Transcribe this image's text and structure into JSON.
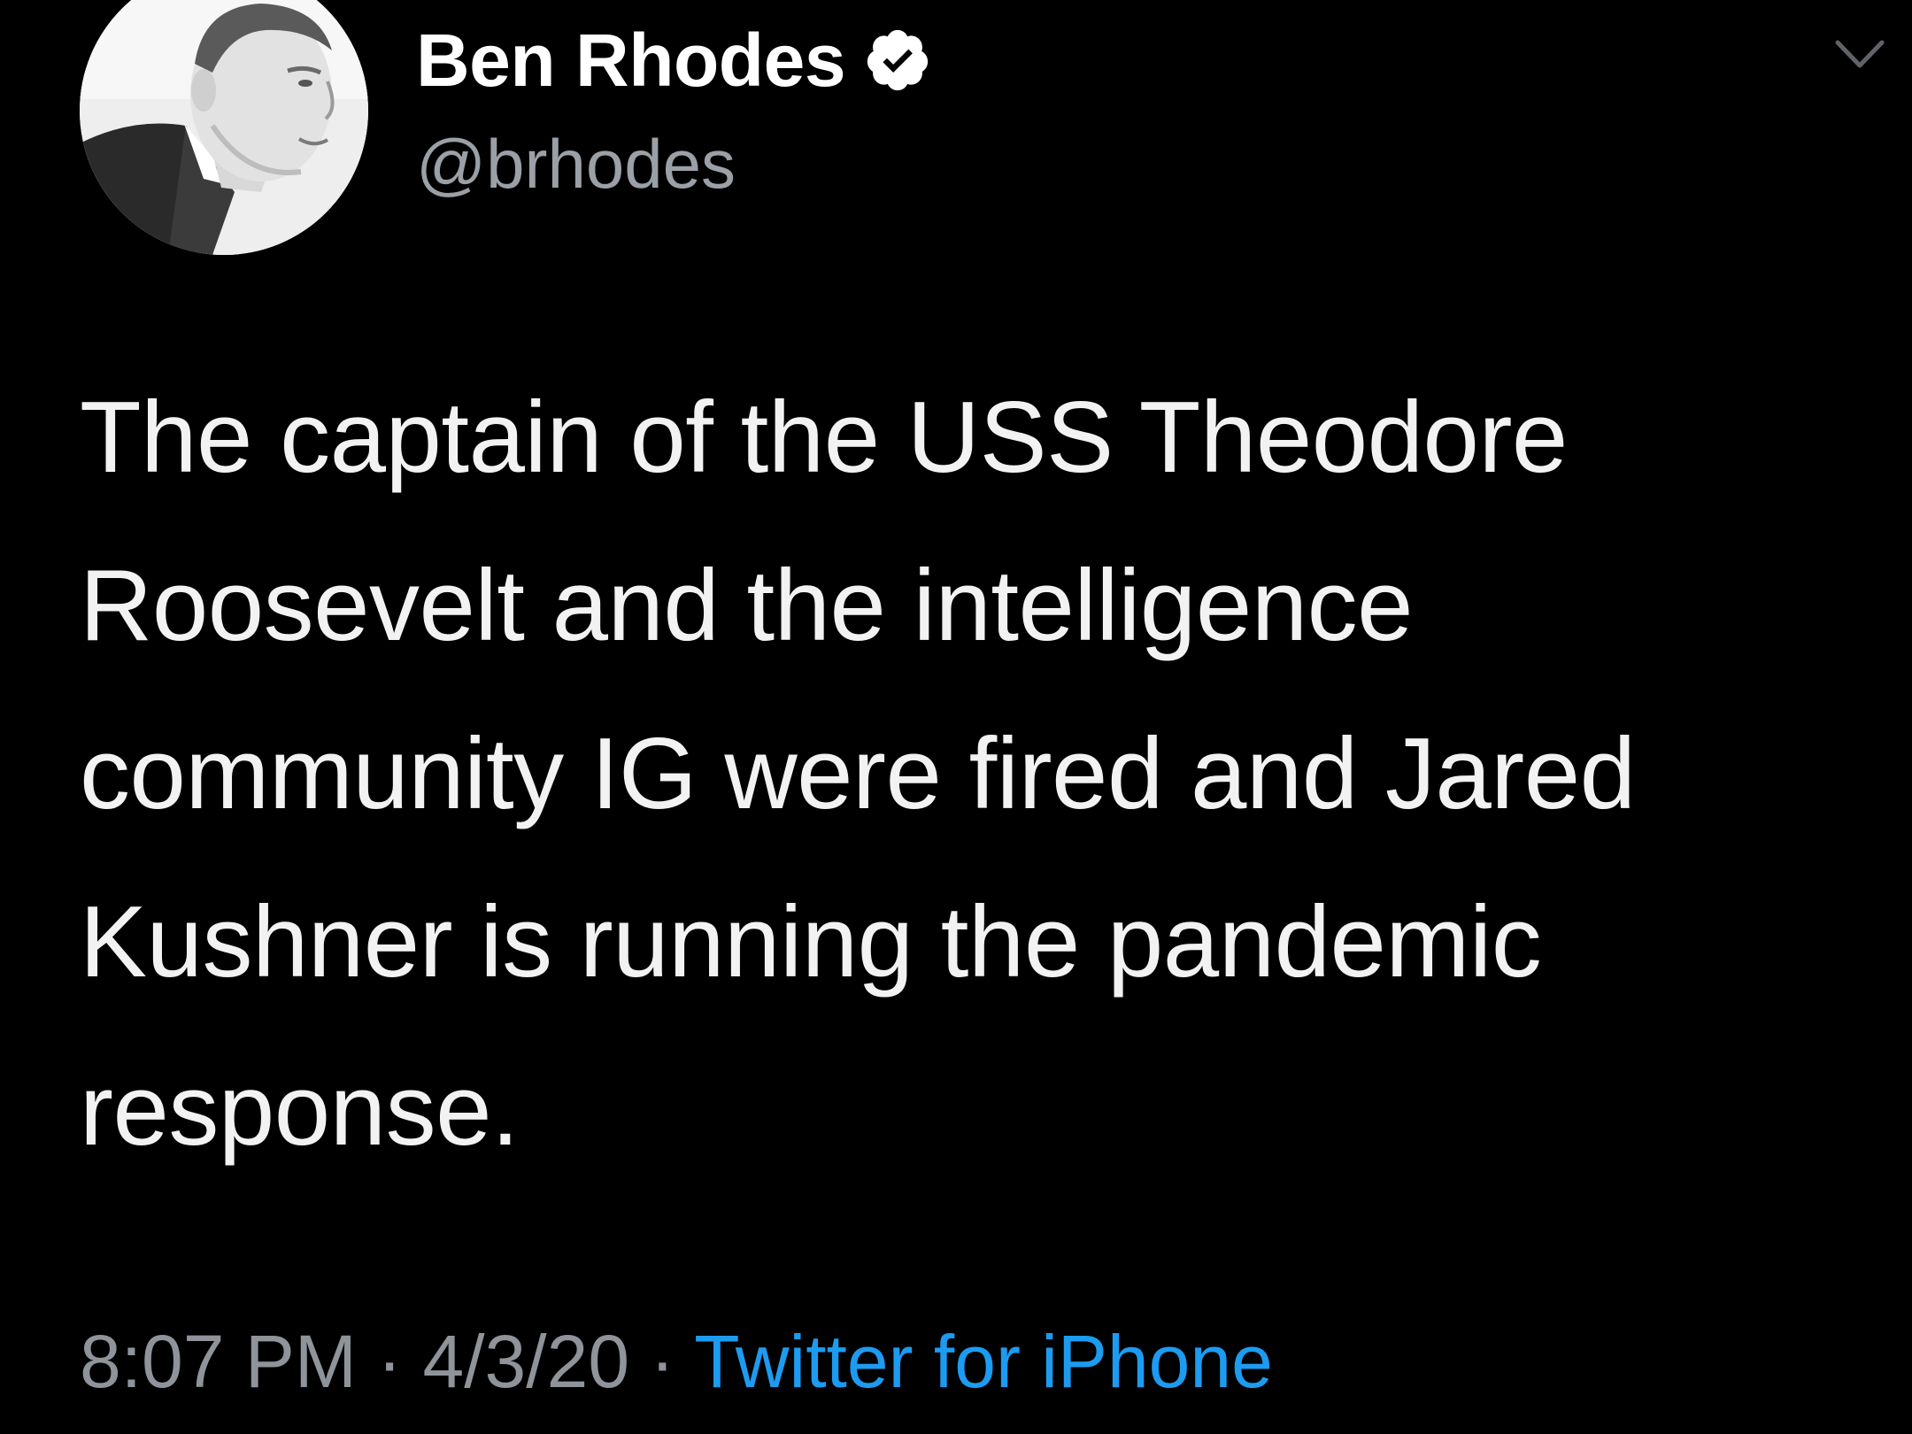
{
  "tweet": {
    "author": {
      "display_name": "Ben Rhodes",
      "handle": "@brhodes",
      "verified_icon": "verified-badge-icon",
      "avatar_icon": "profile-photo"
    },
    "menu_icon": "chevron-down-icon",
    "text": "The captain of the USS Theodore Roosevelt and the intelligence community IG were fired and Jared Kushner is running the pandemic response.",
    "time": "8:07 PM",
    "separator": "·",
    "date": "4/3/20",
    "source": "Twitter for iPhone"
  },
  "colors": {
    "background": "#000000",
    "text": "#f2f2f2",
    "secondary_text": "#8f949a",
    "link": "#1d9bf0"
  }
}
